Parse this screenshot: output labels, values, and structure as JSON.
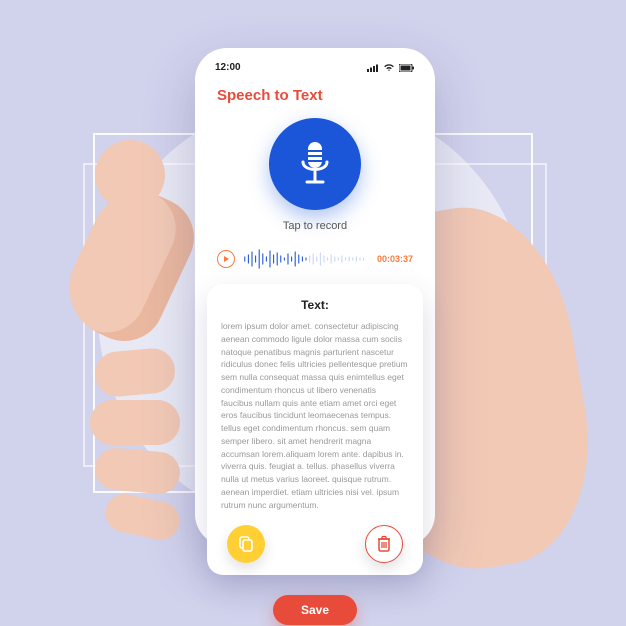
{
  "status_bar": {
    "time": "12:00"
  },
  "app": {
    "title": "Speech to Text",
    "tap_label": "Tap to record"
  },
  "playback": {
    "timestamp": "00:03:37"
  },
  "transcript": {
    "heading": "Text:",
    "body": "lorem ipsum dolor amet. consectetur adipiscing aenean commodo ligule dolor massa cum sociis natoque penatibus magnis parturient nascetur ridiculus donec felis ultricies pellentesque pretium  sem nulla consequat massa quis enimtellus eget condimentum rhoncus  ut  libero venenatis faucibus nullam quis ante etiam amet orci eget eros faucibus tincidunt  leomaecenas tempus. tellus eget condimentum rhoncus. sem quam semper libero. sit amet hendrerit magna accumsan lorem.aliquam lorem ante. dapibus in. viverra quis. feugiat a. tellus. phasellus viverra nulla ut metus varius laoreet. quisque rutrum. aenean imperdiet. etiam ultricies nisi vel. ipsum rutrum nunc argumentum."
  },
  "buttons": {
    "save": "Save"
  },
  "colors": {
    "accent_red": "#e94b3a",
    "accent_blue": "#1b55d8",
    "accent_orange": "#ff7a3a",
    "accent_yellow": "#ffcf33",
    "bg_lavender": "#d1d2ec"
  }
}
